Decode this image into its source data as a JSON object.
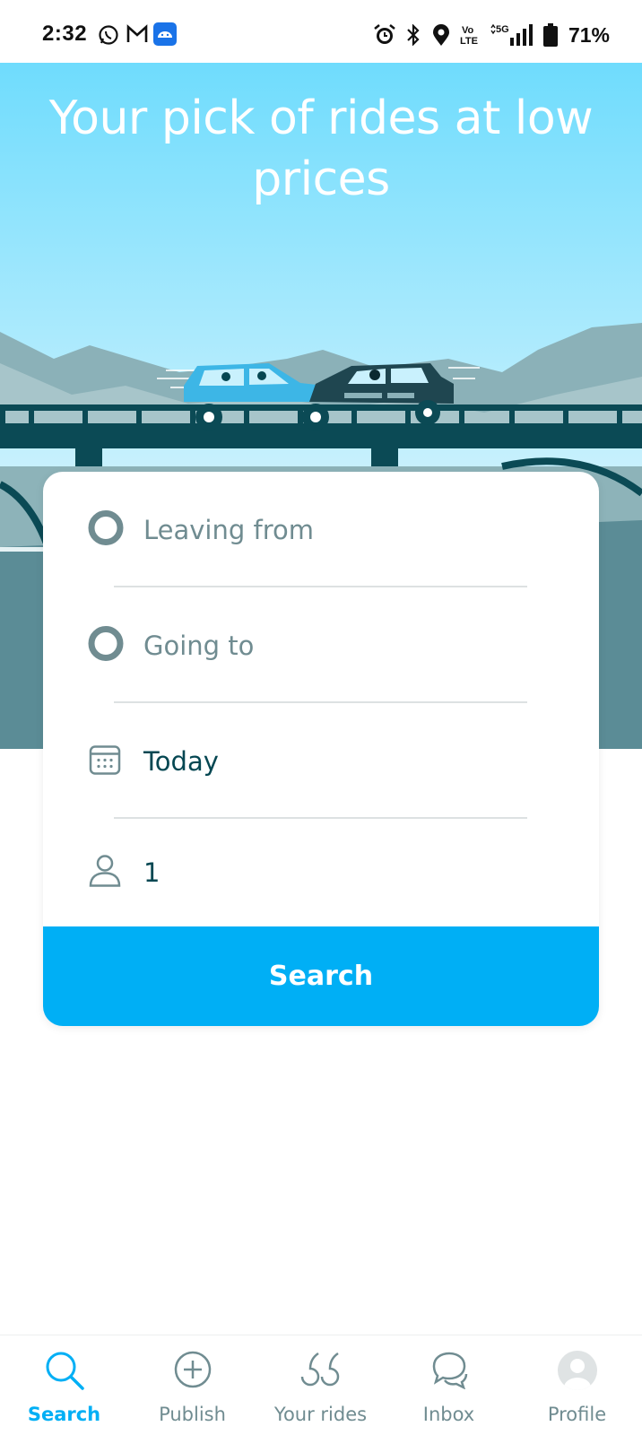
{
  "status_bar": {
    "time": "2:32",
    "battery": "71%",
    "icons": [
      "whatsapp-icon",
      "gmail-icon",
      "android-icon",
      "alarm-icon",
      "bluetooth-icon",
      "location-icon",
      "volte-icon",
      "signal-5g-icon",
      "battery-icon"
    ]
  },
  "hero": {
    "title": "Your pick of rides at low prices"
  },
  "search_form": {
    "leaving_from": {
      "placeholder": "Leaving from",
      "value": ""
    },
    "going_to": {
      "placeholder": "Going to",
      "value": ""
    },
    "date": {
      "value": "Today"
    },
    "passengers": {
      "value": "1"
    },
    "search_label": "Search"
  },
  "bottom_nav": {
    "items": [
      {
        "label": "Search",
        "icon": "search-icon",
        "active": true
      },
      {
        "label": "Publish",
        "icon": "plus-circle-icon",
        "active": false
      },
      {
        "label": "Your rides",
        "icon": "quote-icon",
        "active": false
      },
      {
        "label": "Inbox",
        "icon": "chat-bubbles-icon",
        "active": false
      },
      {
        "label": "Profile",
        "icon": "avatar-icon",
        "active": false
      }
    ]
  },
  "colors": {
    "accent": "#00aff5",
    "text_dark": "#054752",
    "text_muted": "#708c91",
    "sky_top": "#6fdcfd",
    "sky_bottom": "#c7f0fd",
    "bridge": "#0b4a55"
  }
}
